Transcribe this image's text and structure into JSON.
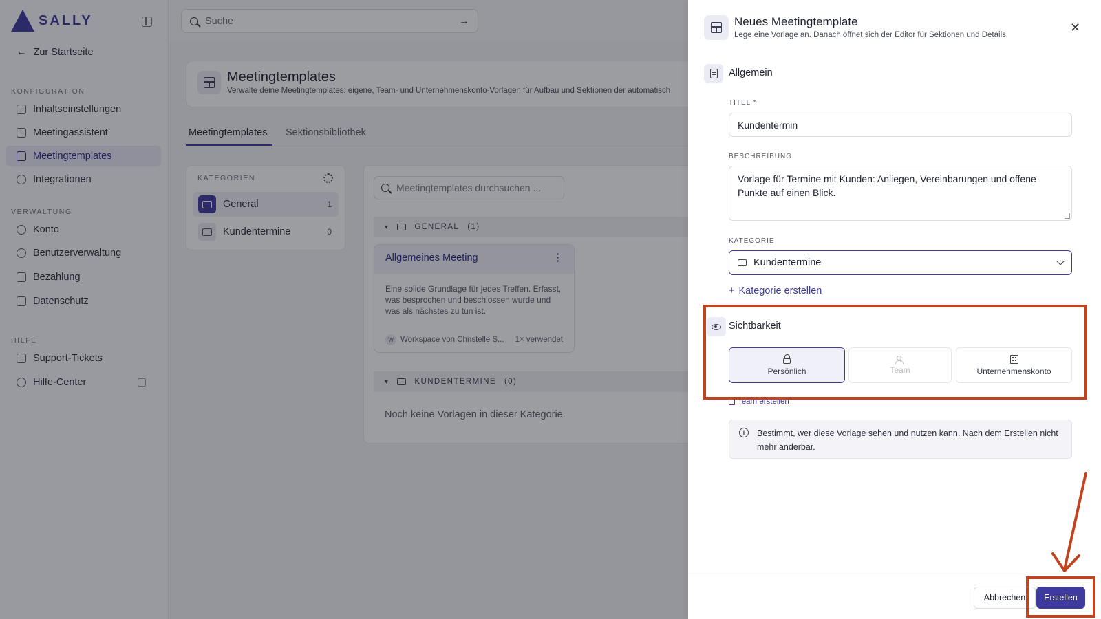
{
  "app": {
    "logo_text": "SALLY",
    "search_placeholder": "Suche",
    "back_label": "Zur Startseite"
  },
  "sidebar": {
    "sections": [
      {
        "label": "KONFIGURATION"
      },
      {
        "label": "VERWALTUNG"
      },
      {
        "label": "HILFE"
      }
    ],
    "items": [
      {
        "label": "Inhaltseinstellungen"
      },
      {
        "label": "Meetingassistent"
      },
      {
        "label": "Meetingtemplates"
      },
      {
        "label": "Integrationen"
      },
      {
        "label": "Konto"
      },
      {
        "label": "Benutzerverwaltung"
      },
      {
        "label": "Bezahlung"
      },
      {
        "label": "Datenschutz"
      },
      {
        "label": "Support-Tickets"
      },
      {
        "label": "Hilfe-Center"
      }
    ]
  },
  "page": {
    "title": "Meetingtemplates",
    "subtitle": "Verwalte deine Meetingtemplates: eigene, Team- und Unternehmenskonto-Vorlagen für Aufbau und Sektionen der automatisch",
    "tabs": [
      {
        "label": "Meetingtemplates"
      },
      {
        "label": "Sektionsbibliothek"
      }
    ]
  },
  "categories": {
    "label": "KATEGORIEN",
    "items": [
      {
        "label": "General",
        "count": "1"
      },
      {
        "label": "Kundentermine",
        "count": "0"
      }
    ]
  },
  "templates": {
    "search_placeholder": "Meetingtemplates durchsuchen ...",
    "groups": [
      {
        "label": "GENERAL",
        "count": "(1)"
      },
      {
        "label": "KUNDENTERMINE",
        "count": "(0)"
      }
    ],
    "card": {
      "title": "Allgemeines Meeting",
      "description": "Eine solide Grundlage für jedes Treffen. Erfasst, was besprochen und beschlossen wurde und was als nächstes zu tun ist.",
      "workspace_initial": "W",
      "workspace": "Workspace von Christelle S...",
      "usage": "1× verwendet"
    },
    "empty_text": "Noch keine Vorlagen in dieser Kategorie."
  },
  "drawer": {
    "title": "Neues Meetingtemplate",
    "subtitle": "Lege eine Vorlage an. Danach öffnet sich der Editor für Sektionen und Details.",
    "general_title": "Allgemein",
    "title_label": "TITEL *",
    "title_value": "Kundentermin",
    "description_label": "BESCHREIBUNG",
    "description_value": "Vorlage für Termine mit Kunden: Anliegen, Vereinbarungen und offene Punkte auf einen Blick.",
    "category_label": "KATEGORIE",
    "category_value": "Kundentermine",
    "add_category": "Kategorie erstellen",
    "visibility_title": "Sichtbarkeit",
    "visibility_options": [
      {
        "label": "Persönlich",
        "state": "selected"
      },
      {
        "label": "Team",
        "state": "disabled"
      },
      {
        "label": "Unternehmenskonto",
        "state": "available"
      }
    ],
    "team_link": "Team erstellen",
    "info_text": "Bestimmt, wer diese Vorlage sehen und nutzen kann. Nach dem Erstellen nicht mehr änderbar.",
    "cancel_label": "Abbrechen",
    "create_label": "Erstellen"
  },
  "colors": {
    "accent": "#3f3a9e",
    "annotation": "#c0441f",
    "overlay": "rgba(20,22,30,0.42)"
  },
  "icons": {
    "close": "close-icon",
    "visibility": "eye-icon",
    "general": "document-icon"
  }
}
